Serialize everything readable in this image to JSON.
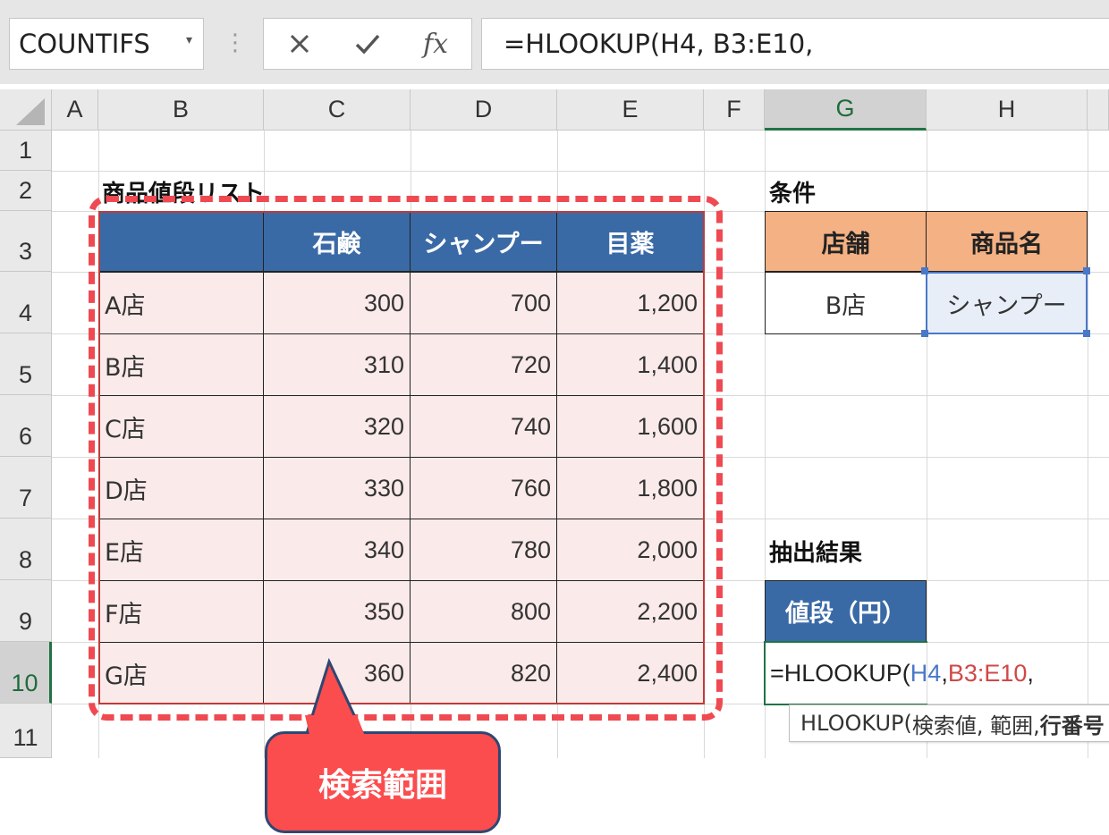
{
  "formula_bar": {
    "name_box": "COUNTIFS",
    "formula": "=HLOOKUP(H4, B3:E10,"
  },
  "columns": [
    "A",
    "B",
    "C",
    "D",
    "E",
    "F",
    "G",
    "H"
  ],
  "rows": [
    "1",
    "2",
    "3",
    "4",
    "5",
    "6",
    "7",
    "8",
    "9",
    "10",
    "11"
  ],
  "price_table": {
    "title": "商品値段リスト",
    "headers": [
      "",
      "石鹸",
      "シャンプー",
      "目薬"
    ],
    "rows": [
      {
        "store": "A店",
        "values": [
          "300",
          "700",
          "1,200"
        ]
      },
      {
        "store": "B店",
        "values": [
          "310",
          "720",
          "1,400"
        ]
      },
      {
        "store": "C店",
        "values": [
          "320",
          "740",
          "1,600"
        ]
      },
      {
        "store": "D店",
        "values": [
          "330",
          "760",
          "1,800"
        ]
      },
      {
        "store": "E店",
        "values": [
          "340",
          "780",
          "2,000"
        ]
      },
      {
        "store": "F店",
        "values": [
          "350",
          "800",
          "2,200"
        ]
      },
      {
        "store": "G店",
        "values": [
          "360",
          "820",
          "2,400"
        ]
      }
    ]
  },
  "conditions": {
    "title": "条件",
    "headers": [
      "店舗",
      "商品名"
    ],
    "values": [
      "B店",
      "シャンプー"
    ]
  },
  "result": {
    "title": "抽出結果",
    "header": "値段（円）",
    "formula_parts": [
      "=HLOOKUP(",
      "H4",
      ", ",
      "B3:E10",
      ","
    ]
  },
  "tooltip": {
    "func": "HLOOKUP(",
    "args": "検索値, 範囲, ",
    "current_arg": "行番号"
  },
  "callout": {
    "text": "検索範囲"
  },
  "colors": {
    "table_header": "#3a6aa6",
    "table_fill": "#fbeaea",
    "condition_header": "#f4b183",
    "selected_cell": "#e8eef8",
    "callout_fill": "#fb4c4e",
    "dash_border": "#ef4a52",
    "ref_blue": "#4a78c8",
    "ref_red": "#d04848"
  },
  "icons": [
    "cancel-icon",
    "enter-icon",
    "insert-function-icon",
    "select-all-icon"
  ]
}
